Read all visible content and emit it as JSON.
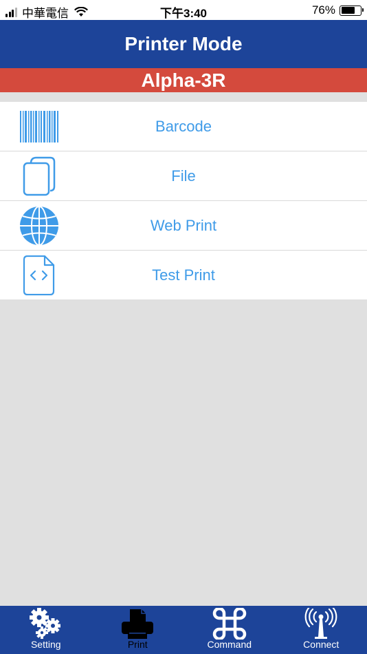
{
  "status_bar": {
    "carrier": "中華電信",
    "time": "下午3:40",
    "battery_text": "76%",
    "battery_level": 0.76
  },
  "nav": {
    "title": "Printer Mode"
  },
  "model": {
    "name": "Alpha-3R"
  },
  "menu": {
    "items": [
      {
        "label": "Barcode",
        "icon": "barcode-icon"
      },
      {
        "label": "File",
        "icon": "copy-file-icon"
      },
      {
        "label": "Web Print",
        "icon": "globe-icon"
      },
      {
        "label": "Test Print",
        "icon": "code-file-icon"
      }
    ]
  },
  "tabs": {
    "items": [
      {
        "label": "Setting",
        "icon": "gears-icon",
        "active": false
      },
      {
        "label": "Print",
        "icon": "printer-icon",
        "active": true
      },
      {
        "label": "Command",
        "icon": "command-key-icon",
        "active": false
      },
      {
        "label": "Connect",
        "icon": "antenna-icon",
        "active": false
      }
    ]
  },
  "colors": {
    "nav_blue": "#1d4499",
    "model_red": "#d44a3d",
    "accent_blue": "#3f9be8",
    "background": "#e0e0e0"
  }
}
